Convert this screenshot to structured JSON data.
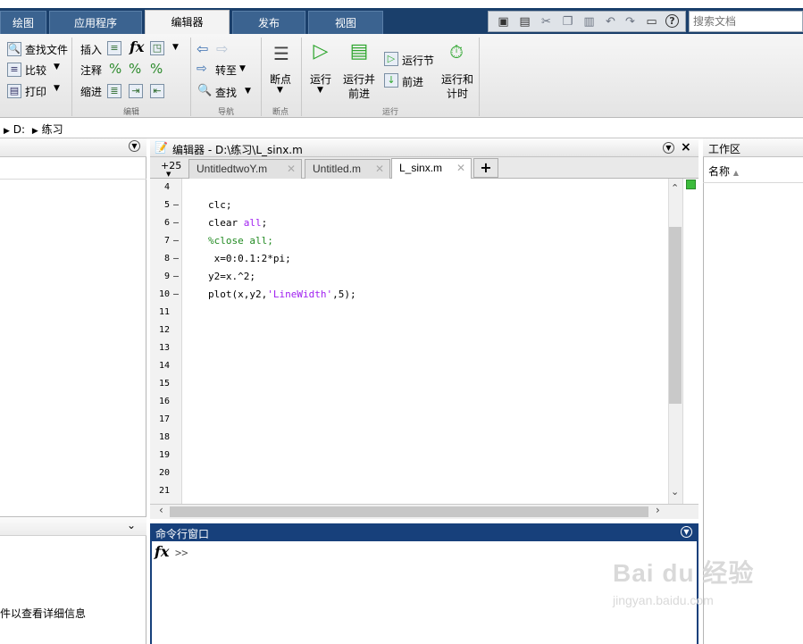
{
  "tabs": [
    {
      "label": "绘图"
    },
    {
      "label": "应用程序"
    },
    {
      "label": "编辑器"
    },
    {
      "label": "发布"
    },
    {
      "label": "视图"
    }
  ],
  "search": {
    "placeholder": "搜索文档"
  },
  "ribbon": {
    "file_group": {
      "find_files": "查找文件",
      "compare": "比较",
      "print": "打印"
    },
    "edit_group": {
      "insert": "插入",
      "comment": "注释",
      "indent": "缩进",
      "label": "编辑",
      "fx": "fx"
    },
    "nav_group": {
      "goto": "转至",
      "find": "查找",
      "label": "导航"
    },
    "breakpoints_group": {
      "breakpoints": "断点",
      "label": "断点"
    },
    "run_group": {
      "run": "运行",
      "run_advance_line1": "运行并",
      "run_advance_line2": "前进",
      "run_section": "运行节",
      "advance": "前进",
      "run_time_line1": "运行和",
      "run_time_line2": "计时",
      "label": "运行"
    }
  },
  "path": {
    "drive": "D:",
    "folder": "练习"
  },
  "left_panel": {
    "details_hint": "件以查看详细信息"
  },
  "editor": {
    "title": "编辑器 - D:\\练习\\L_sinx.m",
    "tab_overflow": "+25",
    "tabs": [
      {
        "label": "UntitledtwoY.m"
      },
      {
        "label": "Untitled.m"
      },
      {
        "label": "L_sinx.m"
      }
    ],
    "add_tab": "+",
    "lines": [
      {
        "num": "4",
        "dash": "",
        "code": ""
      },
      {
        "num": "5",
        "dash": "–",
        "code": "clc;"
      },
      {
        "num": "6",
        "dash": "–",
        "code_parts": [
          "clear ",
          "all",
          ";"
        ]
      },
      {
        "num": "7",
        "dash": "–",
        "comment": "%close all;"
      },
      {
        "num": "8",
        "dash": "–",
        "code": " x=0:0.1:2*pi;"
      },
      {
        "num": "9",
        "dash": "–",
        "code": "y2=x.^2;"
      },
      {
        "num": "10",
        "dash": "–",
        "code_parts": [
          "plot(x,y2,",
          "'LineWidth'",
          ",5);"
        ]
      },
      {
        "num": "11"
      },
      {
        "num": "12"
      },
      {
        "num": "13"
      },
      {
        "num": "14"
      },
      {
        "num": "15"
      },
      {
        "num": "16"
      },
      {
        "num": "17"
      },
      {
        "num": "18"
      },
      {
        "num": "19"
      },
      {
        "num": "20"
      },
      {
        "num": "21"
      }
    ]
  },
  "command_window": {
    "title": "命令行窗口",
    "prompt": ">>",
    "fx": "fx"
  },
  "workspace": {
    "title": "工作区",
    "column_name": "名称"
  },
  "colors": {
    "keyword": "#a020f0",
    "string": "#a020f0",
    "comment": "#228b22",
    "titlebar": "#17407b"
  },
  "watermark": {
    "brand": "Bai du 经验",
    "url": "jingyan.baidu.com"
  }
}
